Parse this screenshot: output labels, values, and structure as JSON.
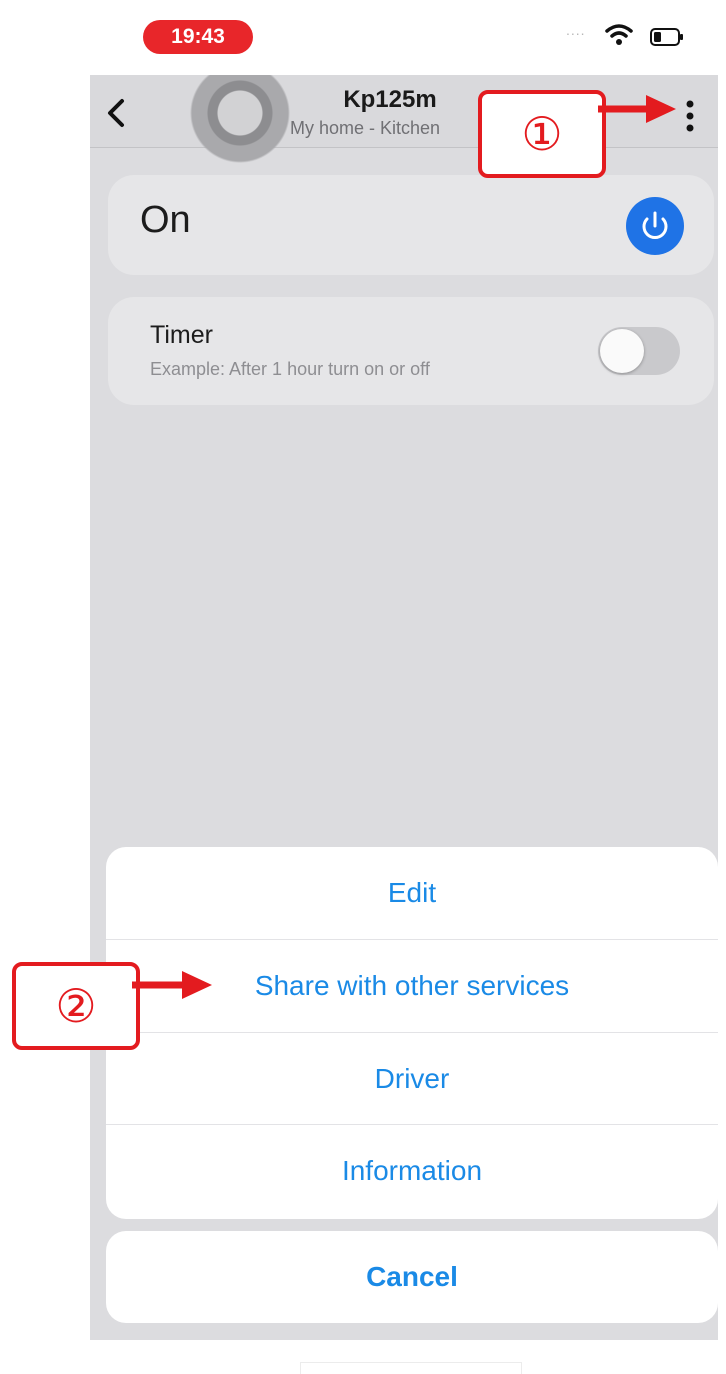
{
  "status_bar": {
    "time": "19:43",
    "signal": "....",
    "icons": [
      "wifi-icon",
      "battery-icon"
    ]
  },
  "header": {
    "back_icon": "chevron-left-icon",
    "title": "Kp125m",
    "subtitle": "My home - Kitchen",
    "more_icon": "vertical-ellipsis-icon"
  },
  "power_card": {
    "label": "On",
    "power_icon": "power-icon",
    "accent_color": "#1f73e6"
  },
  "timer_card": {
    "title": "Timer",
    "subtitle": "Example: After 1 hour turn on or off",
    "toggle_on": false
  },
  "action_sheet": {
    "items": [
      "Edit",
      "Share with other services",
      "Driver",
      "Information"
    ],
    "cancel_label": "Cancel",
    "text_color": "#1a8ae6"
  },
  "annotations": {
    "step1": "①",
    "step2": "②",
    "color": "#e31b1f"
  }
}
